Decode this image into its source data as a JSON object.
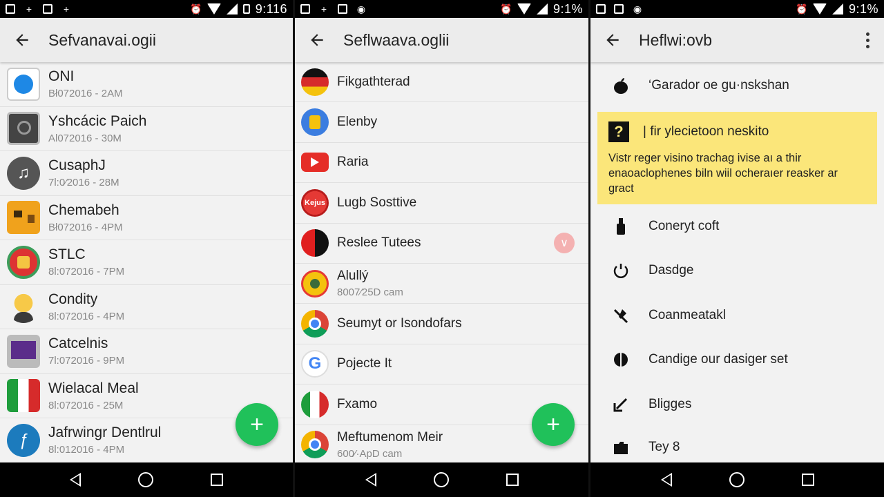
{
  "panels": [
    {
      "status_time": "9:116",
      "title": "Sefvanavai.ogii",
      "items": [
        {
          "name": "ONI",
          "meta": "Bł072016 - 2AM",
          "icon": "blue-circle-app-icon"
        },
        {
          "name": "Yshcácic Paich",
          "meta": "Al072016 - 30M",
          "icon": "radio-device-icon"
        },
        {
          "name": "CusaphJ",
          "meta": "7l:0⁄2016 - 28M",
          "icon": "music-note-icon"
        },
        {
          "name": "Chemabeh",
          "meta": "Bł072016 - 4PM",
          "icon": "pixel-game-icon"
        },
        {
          "name": "STLC",
          "meta": "8l:072016 - 7PM",
          "icon": "gift-badge-icon"
        },
        {
          "name": "Condity",
          "meta": "8l:072016 - 4PM",
          "icon": "sun-person-icon"
        },
        {
          "name": "Catcelnis",
          "meta": "7l:072016 - 9PM",
          "icon": "tv-screen-icon"
        },
        {
          "name": "Wielacal Meal",
          "meta": "8l:072016 - 25M",
          "icon": "italy-flag-icon"
        },
        {
          "name": "Jafrwingr Dentlrul",
          "meta": "8l:012016 - 4PM",
          "icon": "feather-pen-icon"
        }
      ],
      "fab_label": "+"
    },
    {
      "status_time": "9:1%",
      "title": "Seflwaava.oglii",
      "items": [
        {
          "name": "Fikgathterad",
          "meta": "",
          "icon": "germany-flag-icon"
        },
        {
          "name": "Elenby",
          "meta": "",
          "icon": "blue-yellow-app-icon"
        },
        {
          "name": "Raria",
          "meta": "",
          "icon": "youtube-play-icon"
        },
        {
          "name": "Lugb Sosttive",
          "meta": "",
          "icon": "red-badge-icon"
        },
        {
          "name": "Reslee Tutees",
          "meta": "",
          "icon": "red-black-circle-icon"
        },
        {
          "name": "Alullý",
          "meta": "8007⁄25D cam",
          "icon": "yellow-camera-icon"
        },
        {
          "name": "Seumyt or Isondofars",
          "meta": "",
          "icon": "chrome-icon"
        },
        {
          "name": "Pojecte It",
          "meta": "",
          "icon": "google-g-icon"
        },
        {
          "name": "Fxamo",
          "meta": "",
          "icon": "italy-flag-icon"
        },
        {
          "name": "Meftumenom Meir",
          "meta": "600⁄·ApD cam",
          "icon": "chrome-icon"
        }
      ],
      "fab_label": "+"
    },
    {
      "status_time": "9:1%",
      "title": "Heflwi:ovb",
      "header_item": "‘Garador oe gu·nskshan",
      "tip": {
        "title": "| fir ylecietoon neskito",
        "body": "Vistr reger visino trachag ivise aı a thir enaoaclophenes biln wiil ocheraıer reasker ar gract"
      },
      "items": [
        {
          "label": "Coneryt coft",
          "icon": "bottle-icon"
        },
        {
          "label": "Dasdge",
          "icon": "power-icon"
        },
        {
          "label": "Coanmeatakl",
          "icon": "pen-slash-icon"
        },
        {
          "label": "Candige our dasiger set",
          "icon": "half-circle-icon"
        },
        {
          "label": "Bligges",
          "icon": "arrow-down-left-icon"
        },
        {
          "label": "Tey 8",
          "icon": "folder-icon"
        }
      ]
    }
  ],
  "colors": {
    "fab": "#20c15a",
    "tip_background": "#fbe67a",
    "chevron_badge": "#f4b1b1"
  }
}
